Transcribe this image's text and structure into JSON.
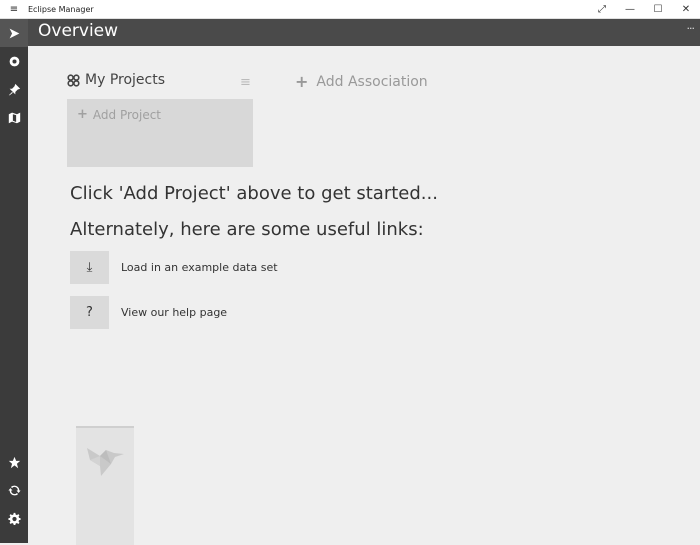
{
  "window": {
    "app_title": "Eclipse Manager",
    "controls": {
      "expand": "⤢",
      "minimize": "—",
      "maximize": "☐",
      "close": "✕"
    }
  },
  "rail": {
    "items": [
      {
        "icon": "send-icon",
        "selected": true
      },
      {
        "icon": "record-icon",
        "selected": false
      },
      {
        "icon": "pin-icon",
        "selected": false
      },
      {
        "icon": "map-icon",
        "selected": false
      }
    ],
    "bottom_items": [
      {
        "icon": "star-icon"
      },
      {
        "icon": "sync-icon"
      },
      {
        "icon": "settings-icon"
      }
    ]
  },
  "header": {
    "title": "Overview",
    "more": "···"
  },
  "projects": {
    "heading": "My Projects",
    "add_project_label": "Add Project",
    "add_association_label": "Add Association"
  },
  "messages": {
    "get_started": "Click 'Add Project' above to get started...",
    "alternately": "Alternately, here are some useful links:"
  },
  "links": [
    {
      "icon": "download-icon",
      "glyph": "⤓",
      "label": "Load in an example data set"
    },
    {
      "icon": "help-icon",
      "glyph": "?",
      "label": "View our help page"
    }
  ],
  "colors": {
    "rail_bg": "#3b3b3b",
    "header_bg": "#4a4a4a",
    "content_bg": "#efefef",
    "card_bg": "#d8d8d8"
  }
}
